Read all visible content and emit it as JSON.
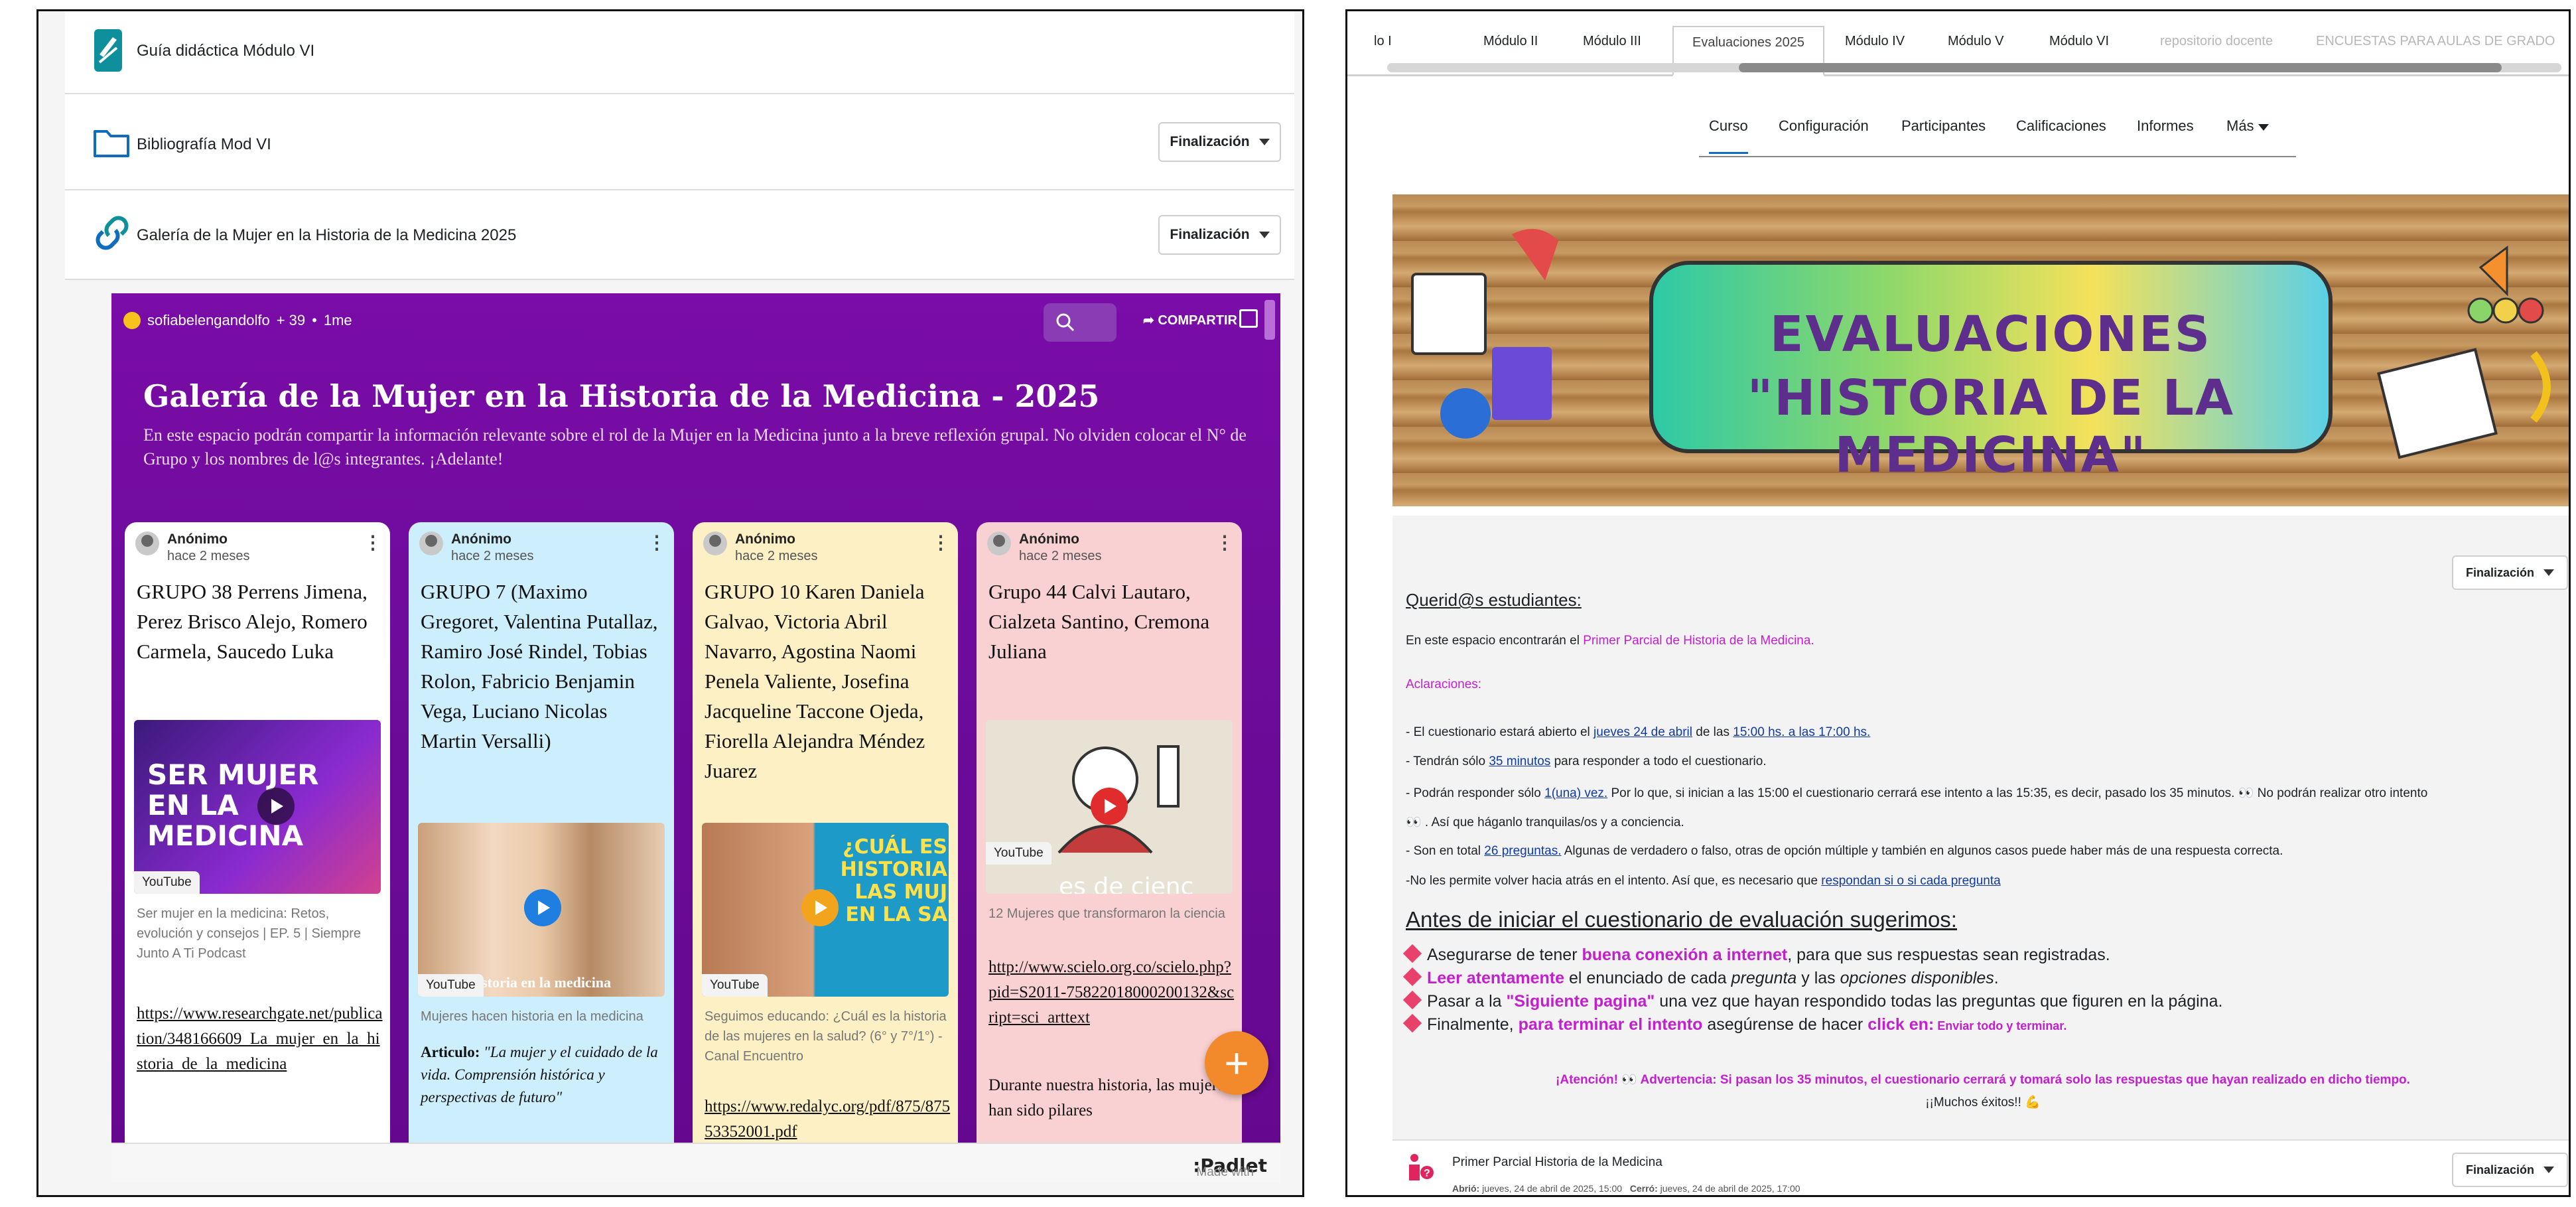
{
  "left": {
    "rows": [
      {
        "label": "Guía didáctica Módulo VI"
      },
      {
        "label": "Bibliografía Mod VI",
        "button": "Finalización"
      },
      {
        "label": "Galería de la Mujer en la Historia de la Medicina 2025",
        "button": "Finalización"
      }
    ],
    "padlet": {
      "user": "sofiabelengandolfo",
      "plus": "+ 39",
      "age": "1me",
      "share": "COMPARTIR",
      "title": "Galería de la Mujer en la Historia de la Medicina - 2025",
      "description": "En este espacio podrán compartir la información relevante sobre el rol de la Mujer en la Medicina junto a la breve reflexión grupal. No olviden colocar el N° de Grupo y los nombres de l@s integrantes. ¡Adelante!",
      "made_with": "Made with",
      "brand": ":Padlet",
      "fab": "+",
      "cards": [
        {
          "author": "Anónimo",
          "time": "hace 2 meses",
          "title": "GRUPO 38 Perrens Jimena, Perez Brisco Alejo, Romero Carmela, Saucedo Luka",
          "thumb_text": "SER MUJER EN LA MEDICINA",
          "source": "YouTube",
          "caption": "Ser mujer en la medicina: Retos, evolución y consejos | EP. 5 | Siempre Junto A Ti Podcast",
          "link": "https://www.researchgate.net/publication/348166609_La_mujer_en_la_historia_de_la_medicina"
        },
        {
          "author": "Anónimo",
          "time": "hace 2 meses",
          "title": "GRUPO 7 (Maximo Gregoret, Valentina Putallaz, Ramiro José Rindel, Tobias Rolon, Fabricio Benjamin Vega, Luciano Nicolas Martin Versalli)",
          "thumb_text": "istoria en la medicina",
          "source": "YouTube",
          "caption": "Mujeres hacen historia en la medicina",
          "article_label": "Articulo:",
          "article": "\"La mujer y el cuidado de la vida. Comprensión histórica y perspectivas de futuro\""
        },
        {
          "author": "Anónimo",
          "time": "hace 2 meses",
          "title": "GRUPO 10 Karen Daniela Galvao, Victoria Abril Navarro, Agostina Naomi Penela Valiente, Josefina Jacqueline Taccone Ojeda, Fiorella Alejandra Méndez Juarez",
          "thumb_text": "¿CUÁL ES HISTORIA LAS MUJ EN LA SA",
          "source": "YouTube",
          "caption": "Seguimos educando: ¿Cuál es la historia de las mujeres en la salud? (6° y 7°/1°) - Canal Encuentro",
          "link": "https://www.redalyc.org/pdf/875/87553352001.pdf"
        },
        {
          "author": "Anónimo",
          "time": "hace 2 meses",
          "title": "Grupo 44 Calvi Lautaro, Cialzeta Santino, Cremona Juliana",
          "thumb_text": "es de cienc",
          "source": "YouTube",
          "caption": "12 Mujeres que transformaron la ciencia",
          "link": "http://www.scielo.org.co/scielo.php?pid=S2011-75822018000200132&script=sci_arttext",
          "body": "Durante nuestra historia, las mujeres han sido pilares"
        }
      ]
    }
  },
  "right": {
    "tabs": [
      "lo I",
      "Módulo II",
      "Módulo III",
      "Evaluaciones 2025",
      "Módulo IV",
      "Módulo V",
      "Módulo VI",
      "repositorio docente",
      "ENCUESTAS PARA AULAS DE GRADO"
    ],
    "subnav": [
      "Curso",
      "Configuración",
      "Participantes",
      "Calificaciones",
      "Informes",
      "Más"
    ],
    "banner": {
      "line1": "EVALUACIONES",
      "line2": "\"HISTORIA DE LA MEDICINA\""
    },
    "finalizacion": "Finalización",
    "greeting": "Querid@s estudiantes:",
    "intro_a": "En este espacio encontrarán el ",
    "intro_b": "Primer Parcial de Historia de la Medicina.",
    "aclaraciones": "Aclaraciones:",
    "l1a": "- El cuestionario estará abierto el ",
    "l1b": "jueves 24 de abril",
    "l1c": " de las ",
    "l1d": "15:00 hs. a las 17:00 hs.",
    "l2a": "- Tendrán sólo ",
    "l2b": "35 minutos",
    "l2c": " para responder a todo el cuestionario.",
    "l3a": "- Podrán responder sólo ",
    "l3b": "1(una) vez.",
    "l3c": " Por lo que, si inician a las 15:00 el cuestionario cerrará ese intento a las 15:35, es decir, pasado los 35 minutos. 👀 No podrán realizar otro intento",
    "l4": "👀 . Así que háganlo tranquilas/os y a conciencia.",
    "l5a": "- Son en total ",
    "l5b": "26 preguntas.",
    "l5c": " Algunas de verdadero o falso, otras de opción múltiple y también en algunos casos puede haber más de una respuesta correcta.",
    "l6a": "-No les permite volver hacia atrás en el intento. Así que, es necesario que ",
    "l6b": "respondan si o si cada pregunta",
    "sug": "Antes de iniciar el cuestionario de evaluación sugerimos:",
    "b1a": "Asegurarse de tener ",
    "b1b": "buena conexión a internet",
    "b1c": ", para que sus respuestas sean registradas.",
    "b2a": "Leer atentamente",
    "b2b": " el enunciado de cada ",
    "b2c": "pregunta",
    "b2d": " y las ",
    "b2e": "opciones disponibles",
    "b2f": ".",
    "b3a": "Pasar a la ",
    "b3b": "\"Siguiente pagina\"",
    "b3c": " una vez que hayan respondido todas las preguntas que figuren en la página.",
    "b4a": "Finalmente, ",
    "b4b": "para terminar el intento",
    "b4c": "  asegúrense de hacer ",
    "b4d": "click en:",
    "b4e": " Enviar todo y terminar.",
    "warn": "¡Atención! 👀  Advertencia: Si pasan los 35 minutos, el cuestionario cerrará y tomará solo las respuestas que hayan realizado en dicho tiempo.",
    "exitos": "¡¡Muchos éxitos!! 💪",
    "quiz": "Primer Parcial Historia de la Medicina",
    "quiz_open_label": "Abrió:",
    "quiz_open": "jueves, 24 de abril de 2025, 15:00",
    "quiz_close_label": "Cerró:",
    "quiz_close": "jueves, 24 de abril de 2025, 17:00"
  },
  "colors": {
    "padlet_purple": "#6d0b9a",
    "accent_pink": "#c31fcf",
    "moodle_blue": "#0f6cbf"
  }
}
